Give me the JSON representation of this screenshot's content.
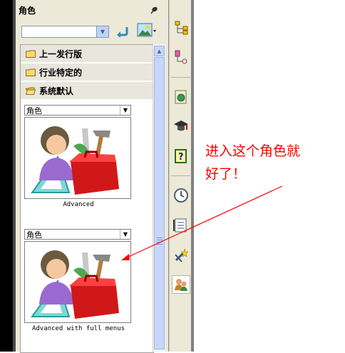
{
  "panel": {
    "title": "角色",
    "combo_value": "",
    "folders": [
      {
        "label": "上一发行版",
        "open": false
      },
      {
        "label": "行业特定的",
        "open": false
      },
      {
        "label": "系统默认",
        "open": true
      }
    ],
    "cards": [
      {
        "select_value": "角色",
        "caption": "Advanced"
      },
      {
        "select_value": "角色",
        "caption": "Advanced with full menus"
      }
    ]
  },
  "right_toolbar": {
    "icons": [
      "assembly-tree-icon",
      "component-tree-icon",
      "globe-page-icon",
      "graduation-cap-icon",
      "help-icon",
      "clock-icon",
      "checklist-icon",
      "tools-star-icon",
      "roles-icon"
    ],
    "active": "roles-icon"
  },
  "annotation": {
    "line1": "进入这个角色就",
    "line2": "好了！",
    "color": "#ff0000"
  }
}
